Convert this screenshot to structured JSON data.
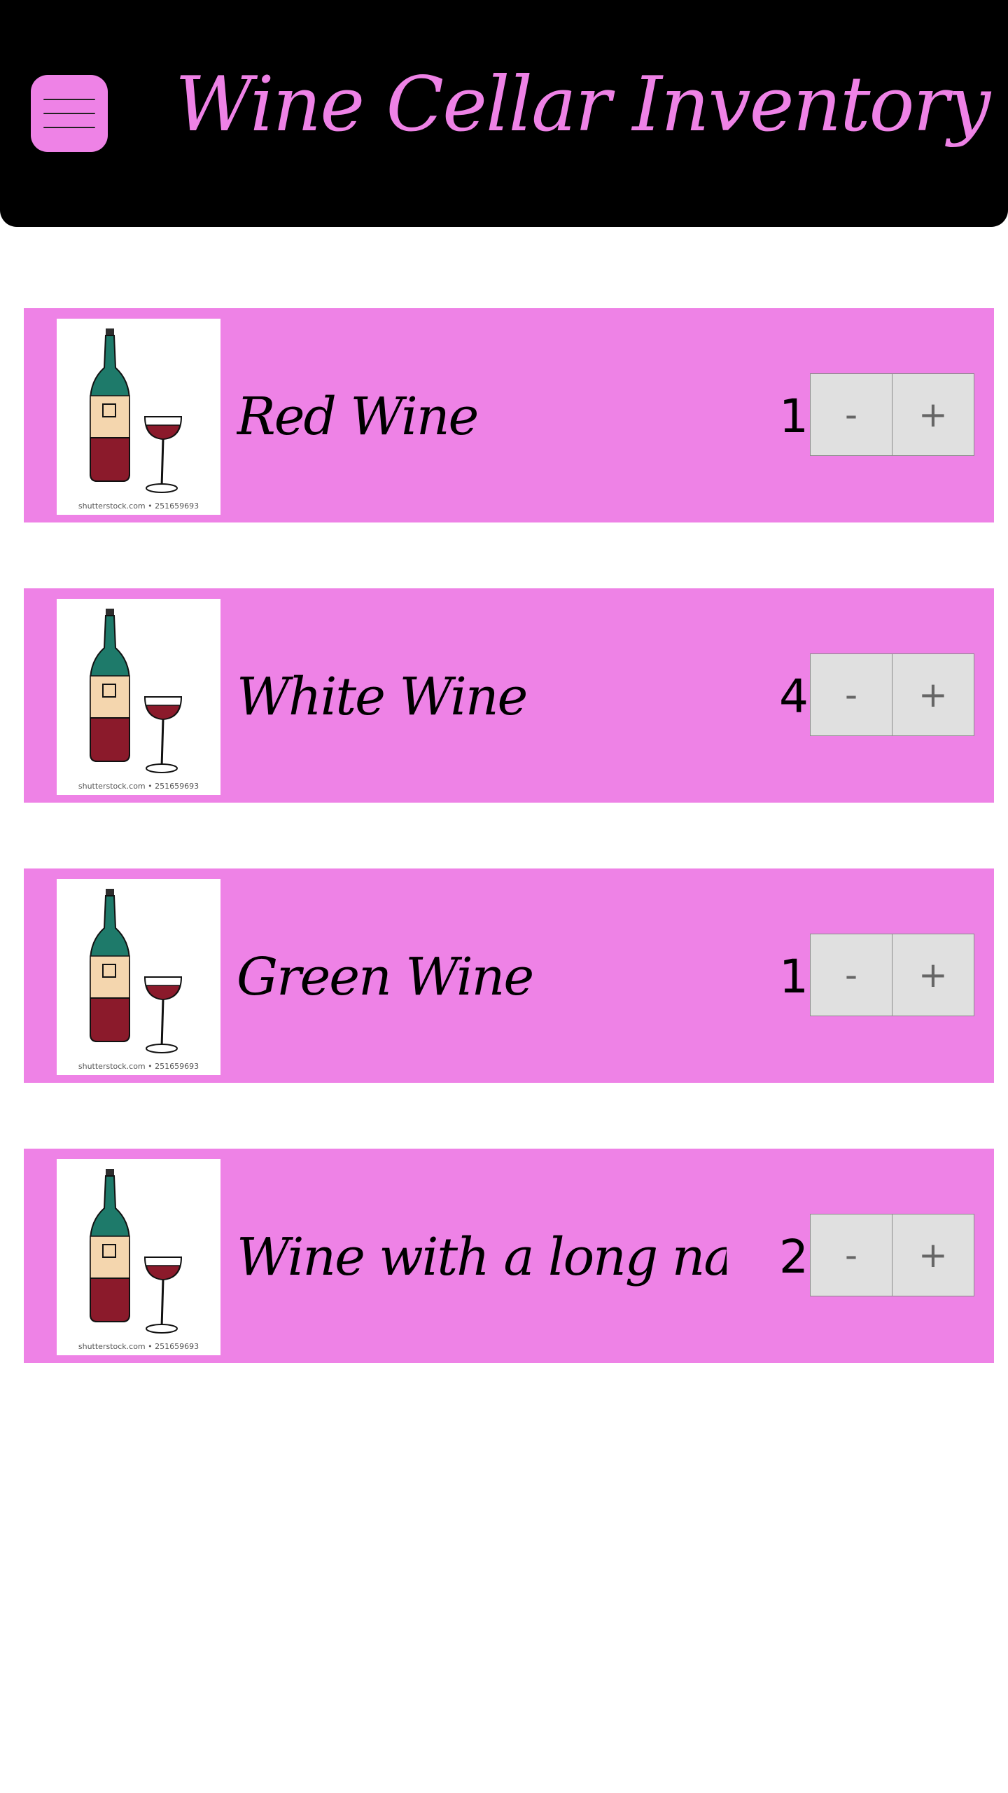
{
  "header": {
    "title": "Wine Cellar Inventory",
    "menu_icon": "hamburger-menu-icon"
  },
  "colors": {
    "accent": "#ee82e6",
    "header_bg": "#000000",
    "button_bg": "#e0e0e0"
  },
  "items": [
    {
      "name": "Red Wine",
      "quantity": "1",
      "image_caption": "shutterstock.com • 251659693",
      "decrement_label": "-",
      "increment_label": "+"
    },
    {
      "name": "White Wine",
      "quantity": "4",
      "image_caption": "shutterstock.com • 251659693",
      "decrement_label": "-",
      "increment_label": "+"
    },
    {
      "name": "Green Wine",
      "quantity": "1",
      "image_caption": "shutterstock.com • 251659693",
      "decrement_label": "-",
      "increment_label": "+"
    },
    {
      "name": "Wine with a long na-",
      "quantity": "2",
      "image_caption": "shutterstock.com • 251659693",
      "decrement_label": "-",
      "increment_label": "+"
    }
  ]
}
